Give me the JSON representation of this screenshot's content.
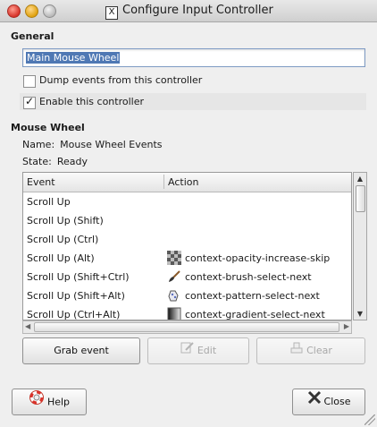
{
  "window": {
    "title": "Configure Input Controller"
  },
  "general": {
    "heading": "General",
    "name_value": "Main Mouse Wheel",
    "dump_events_label": "Dump events from this controller",
    "dump_events_checked": false,
    "enable_label": "Enable this controller",
    "enable_checked": true
  },
  "mouse_wheel": {
    "heading": "Mouse Wheel",
    "name_label": "Name:",
    "name_value": "Mouse Wheel Events",
    "state_label": "State:",
    "state_value": "Ready"
  },
  "table": {
    "columns": [
      "Event",
      "Action"
    ],
    "rows": [
      {
        "event": "Scroll Up",
        "action": "",
        "icon": ""
      },
      {
        "event": "Scroll Up (Shift)",
        "action": "",
        "icon": ""
      },
      {
        "event": "Scroll Up (Ctrl)",
        "action": "",
        "icon": ""
      },
      {
        "event": "Scroll Up (Alt)",
        "action": "context-opacity-increase-skip",
        "icon": "opacity-checker-icon"
      },
      {
        "event": "Scroll Up (Shift+Ctrl)",
        "action": "context-brush-select-next",
        "icon": "brush-icon"
      },
      {
        "event": "Scroll Up (Shift+Alt)",
        "action": "context-pattern-select-next",
        "icon": "pattern-icon"
      },
      {
        "event": "Scroll Up (Ctrl+Alt)",
        "action": "context-gradient-select-next",
        "icon": "gradient-icon"
      }
    ]
  },
  "buttons": {
    "grab": "Grab event",
    "edit": "Edit",
    "clear": "Clear",
    "help": "Help",
    "close": "Close"
  }
}
